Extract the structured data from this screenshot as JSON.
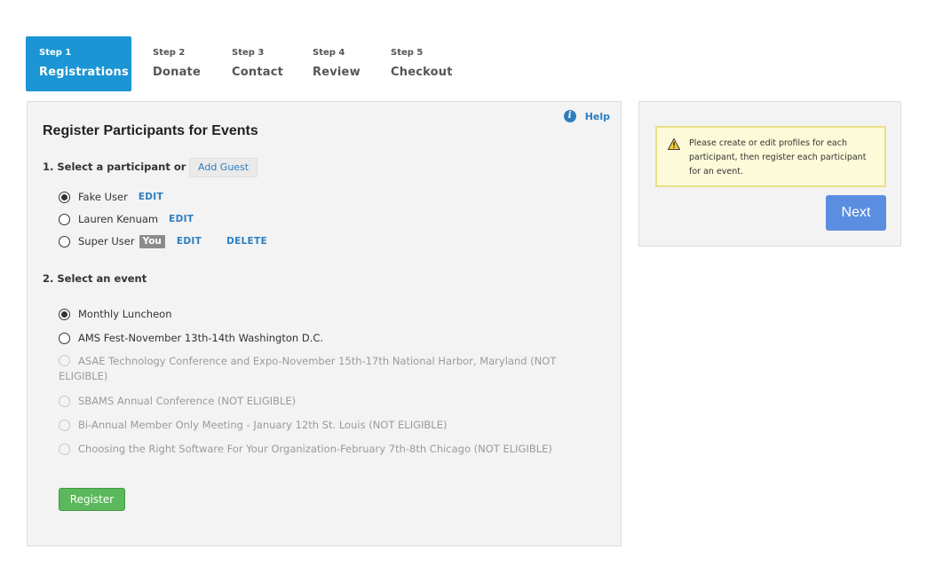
{
  "steps": [
    {
      "number": "Step 1",
      "label": "Registrations",
      "active": true
    },
    {
      "number": "Step 2",
      "label": "Donate"
    },
    {
      "number": "Step 3",
      "label": "Contact"
    },
    {
      "number": "Step 4",
      "label": "Review"
    },
    {
      "number": "Step 5",
      "label": "Checkout"
    }
  ],
  "panel": {
    "title": "Register Participants for Events",
    "help_label": "Help",
    "help_icon": "info-icon",
    "section1_title": "1. Select a participant or",
    "add_guest_label": "Add Guest",
    "participants": [
      {
        "name": "Fake User",
        "selected": true,
        "edit_label": "EDIT"
      },
      {
        "name": "Lauren Kenuam",
        "selected": false,
        "edit_label": "EDIT"
      },
      {
        "name": "Super User",
        "selected": false,
        "badge": "You",
        "edit_label": "EDIT",
        "delete_label": "DELETE"
      }
    ],
    "section2_title": "2. Select an event",
    "events": [
      {
        "label": "Monthly Luncheon",
        "selected": true,
        "eligible": true
      },
      {
        "label": "AMS Fest-November 13th-14th Washington D.C.",
        "selected": false,
        "eligible": true
      },
      {
        "label": "ASAE Technology Conference and Expo-November 15th-17th National Harbor, Maryland (NOT ELIGIBLE)",
        "selected": false,
        "eligible": false
      },
      {
        "label": "SBAMS Annual Conference (NOT ELIGIBLE)",
        "selected": false,
        "eligible": false
      },
      {
        "label": "Bi-Annual Member Only Meeting - January 12th St. Louis (NOT ELIGIBLE)",
        "selected": false,
        "eligible": false
      },
      {
        "label": "Choosing the Right Software For Your Organization-February 7th-8th Chicago (NOT ELIGIBLE)",
        "selected": false,
        "eligible": false
      }
    ],
    "register_label": "Register"
  },
  "sidebar": {
    "notice_icon": "warning-icon",
    "notice_text": "Please create or edit profiles for each participant, then register each participant for an event.",
    "next_label": "Next"
  },
  "colors": {
    "active_step": "#1b95d3",
    "link": "#2d7ec0",
    "register_button": "#5cb85c",
    "next_button": "#5b8ee1",
    "notice_bg": "#fcfad8"
  }
}
